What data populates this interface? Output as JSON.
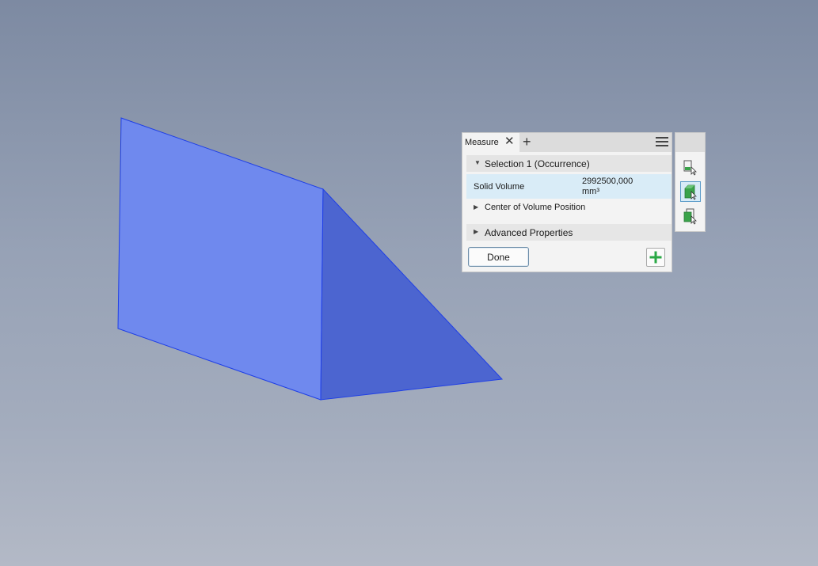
{
  "measure_panel": {
    "tab_label": "Measure",
    "selection_header": "Selection 1 (Occurrence)",
    "solid_volume_label": "Solid Volume",
    "solid_volume_value_line1": "2992500,000",
    "solid_volume_value_line2": "mm³",
    "center_of_volume_label": "Center of Volume Position",
    "advanced_properties_label": "Advanced Properties",
    "done_label": "Done"
  },
  "side_toolbar": {
    "tools": [
      {
        "icon": "select-part-icon",
        "active": false
      },
      {
        "icon": "select-body-icon",
        "active": true
      },
      {
        "icon": "select-occurrence-icon",
        "active": false
      }
    ]
  },
  "colors": {
    "background_top": "#7d8aa2",
    "background_bottom": "#b3b9c6",
    "solid_front_face": "#6f89ee",
    "solid_side_face": "#4c65d0",
    "solid_edge": "#1f3fe6",
    "highlight_row": "#d9ecf7",
    "accent_green": "#2aa845"
  }
}
